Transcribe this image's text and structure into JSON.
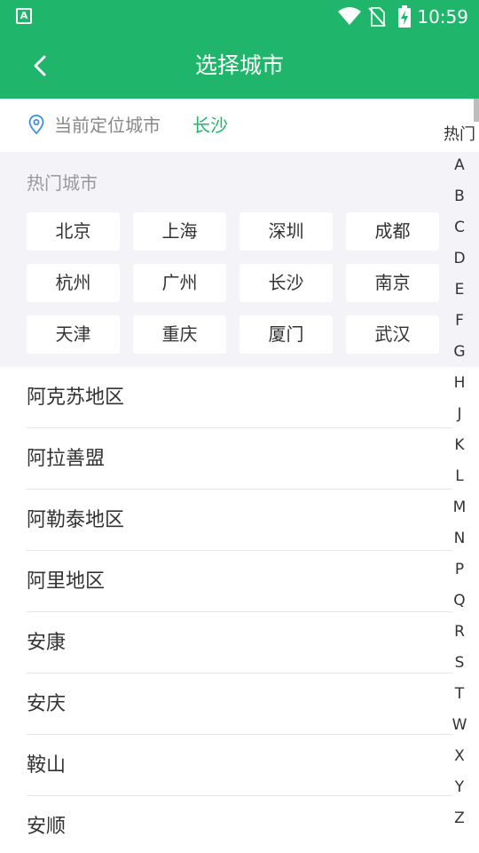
{
  "status_bar": {
    "app_icon_letter": "A",
    "time": "10:59"
  },
  "header": {
    "title": "选择城市"
  },
  "location": {
    "label": "当前定位城市",
    "city": "长沙"
  },
  "hot_cities": {
    "title": "热门城市",
    "items": [
      "北京",
      "上海",
      "深圳",
      "成都",
      "杭州",
      "广州",
      "长沙",
      "南京",
      "天津",
      "重庆",
      "厦门",
      "武汉"
    ]
  },
  "city_list": [
    "阿克苏地区",
    "阿拉善盟",
    "阿勒泰地区",
    "阿里地区",
    "安康",
    "安庆",
    "鞍山",
    "安顺"
  ],
  "index_bar": [
    "热门",
    "A",
    "B",
    "C",
    "D",
    "E",
    "F",
    "G",
    "H",
    "J",
    "K",
    "L",
    "M",
    "N",
    "P",
    "Q",
    "R",
    "S",
    "T",
    "W",
    "X",
    "Y",
    "Z"
  ],
  "colors": {
    "accent": "#1fb56a",
    "section_bg": "#f4f4f8"
  }
}
